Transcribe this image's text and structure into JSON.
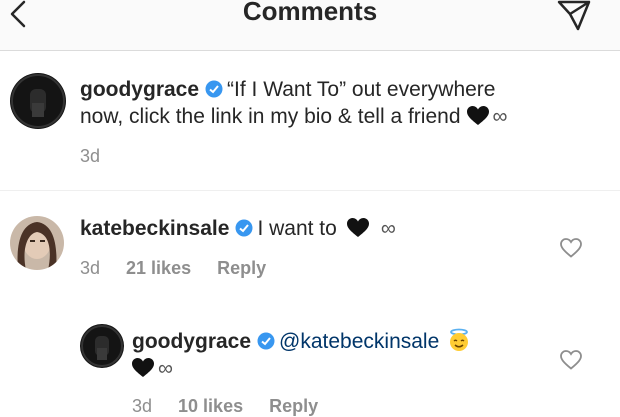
{
  "header": {
    "title": "Comments"
  },
  "comments": [
    {
      "username": "goodygrace",
      "text_line1": "“If I Want To” out everywhere",
      "text_line2": "now, click the link in my bio & tell a friend",
      "infinity": "∞",
      "time": "3d"
    },
    {
      "username": "katebeckinsale",
      "text": "I want to",
      "infinity": "∞",
      "time": "3d",
      "likes": "21 likes",
      "reply": "Reply"
    },
    {
      "username": "goodygrace",
      "mention": "@katebeckinsale",
      "infinity": "∞",
      "time": "3d",
      "likes": "10 likes",
      "reply": "Reply"
    }
  ],
  "colors": {
    "verified": "#3897f0",
    "mention": "#003569",
    "meta": "#8e8e8e"
  },
  "icons": [
    "back-chevron",
    "send-direct",
    "verified-badge",
    "black-heart",
    "heart-outline",
    "smiling-face-with-halo"
  ]
}
